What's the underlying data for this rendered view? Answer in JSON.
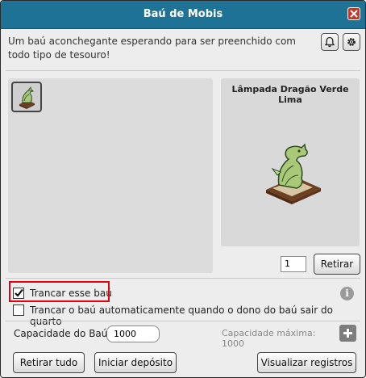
{
  "window": {
    "title": "Baú de Mobis",
    "description": "Um baú aconchegante esperando para ser preenchido com todo tipo de tesouro!"
  },
  "icons": {
    "close": "close-icon",
    "notification": "bell-icon",
    "settings": "gear-icon",
    "info": "info-icon",
    "add": "plus-icon"
  },
  "inventory": {
    "items": [
      {
        "icon": "green-dragon-lamp-icon"
      }
    ]
  },
  "preview": {
    "item_name": "Lâmpada Dragão Verde Lima",
    "quantity": "1",
    "withdraw_label": "Retirar"
  },
  "options": {
    "lock_label": "Trancar esse baú",
    "lock_checked": true,
    "autolock_label": "Trancar o baú automaticamente quando o dono do baú sair do quarto",
    "autolock_checked": false
  },
  "capacity": {
    "label": "Capacidade do Baú:",
    "value": "1000",
    "max_label": "Capacidade máxima: 1000"
  },
  "footer": {
    "withdraw_all": "Retirar tudo",
    "start_deposit": "Iniciar depósito",
    "view_logs": "Visualizar registros"
  },
  "colors": {
    "titlebar": "#1e7295",
    "close": "#c0392b",
    "highlight": "#e3000f"
  }
}
